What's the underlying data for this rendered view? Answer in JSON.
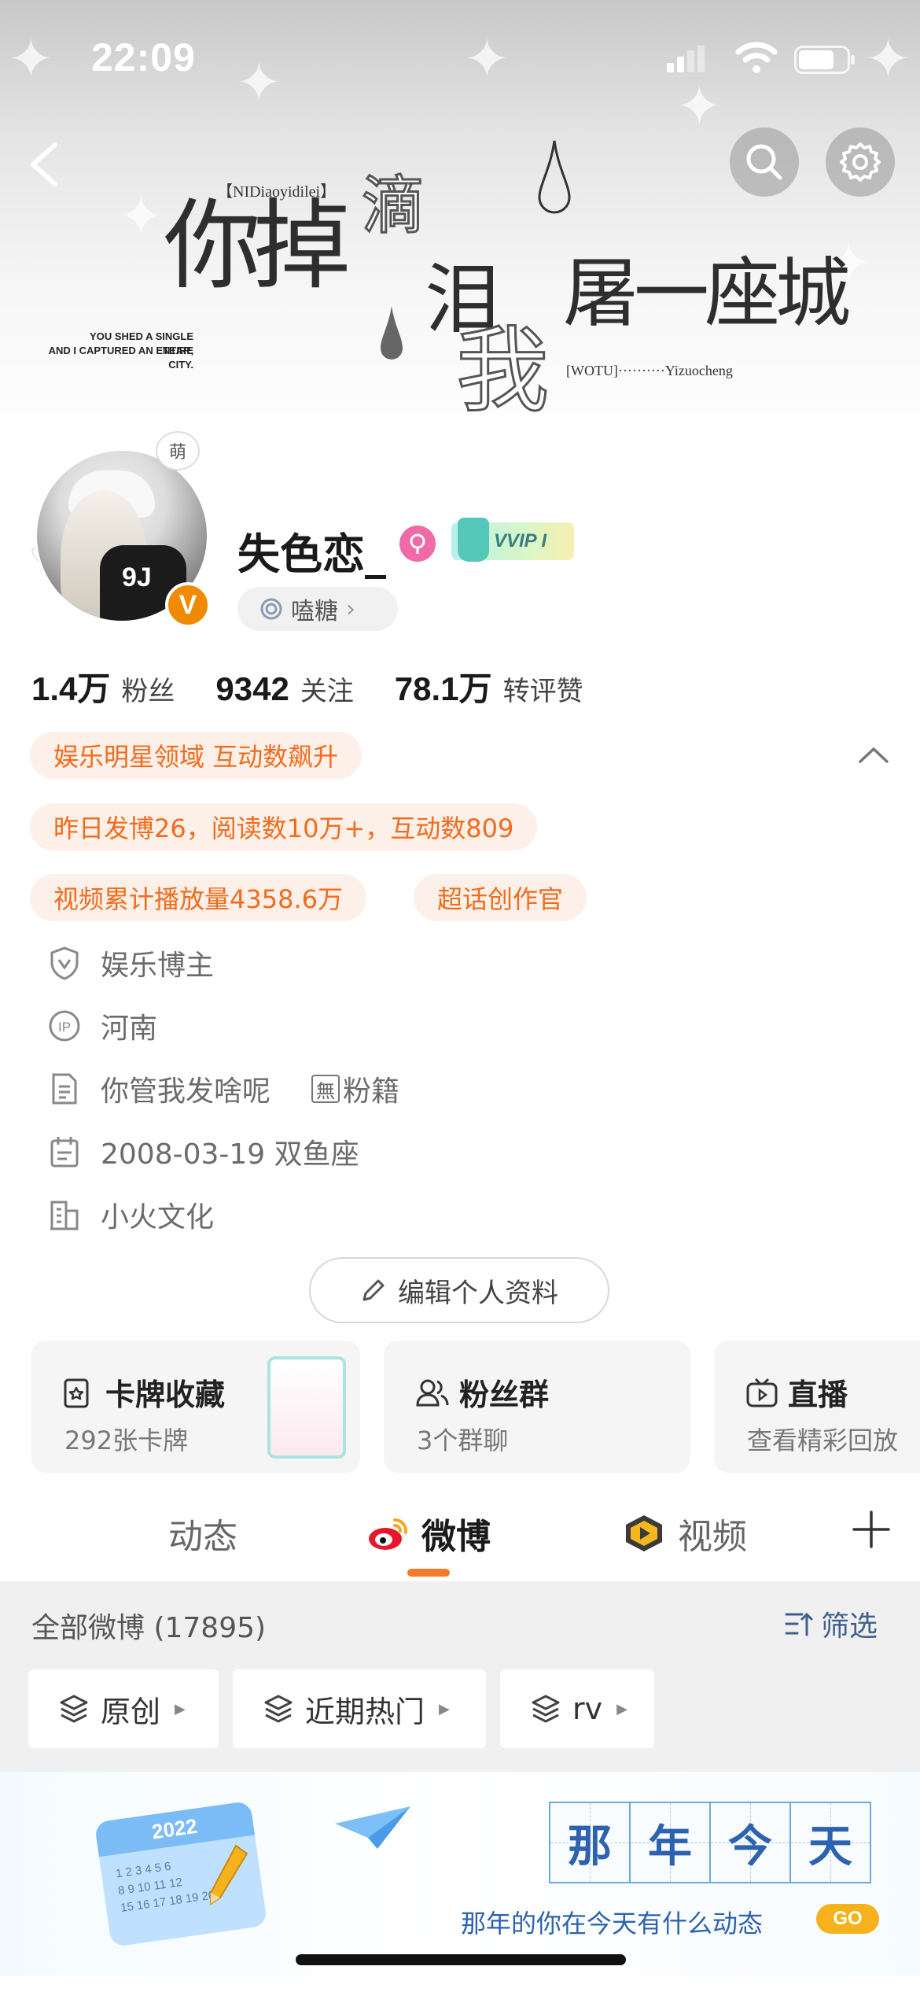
{
  "status": {
    "time": "22:09"
  },
  "cover": {
    "art_tag": "【NIDiaoyidilei】",
    "art_line1": "你掉",
    "art_line1_outline": "滴",
    "art_line2": "泪",
    "art_line2_outline": "我",
    "art_line3": "屠一座城",
    "art_caption_line1": "YOU SHED A SINGLE TEAR,",
    "art_caption_line2": "AND I CAPTURED AN ENTIRE CITY.",
    "art_tag2": "[WOTU]··········Yizuocheng"
  },
  "profile": {
    "name": "失色恋_",
    "vip_label": "VVIP I",
    "avatar_badge": "萌",
    "verified_mark": "V",
    "avatar_shirt_text": "9J",
    "tag_label": "嗑糖",
    "tag_chevron": "›"
  },
  "stats": [
    {
      "num": "1.4万",
      "label": "粉丝"
    },
    {
      "num": "9342",
      "label": "关注"
    },
    {
      "num": "78.1万",
      "label": "转评赞"
    }
  ],
  "honors": [
    "娱乐明星领域 互动数飙升",
    "昨日发博26，阅读数10万+，互动数809",
    "视频累计播放量4358.6万",
    "超话创作官"
  ],
  "info": {
    "role": "娱乐博主",
    "ip": "河南",
    "bio": "你管我发啥呢",
    "fan_box": "無",
    "fan_label": "粉籍",
    "birthday": "2008-03-19 双鱼座",
    "company": "小火文化"
  },
  "edit_label": "编辑个人资料",
  "cards": [
    {
      "title": "卡牌收藏",
      "sub": "292张卡牌"
    },
    {
      "title": "粉丝群",
      "sub": "3个群聊"
    },
    {
      "title": "直播",
      "sub": "查看精彩回放"
    }
  ],
  "tabs": [
    {
      "label": "动态"
    },
    {
      "label": "微博"
    },
    {
      "label": "视频"
    }
  ],
  "feed": {
    "count": "全部微博 (17895)",
    "filter": "筛选",
    "chips": [
      "原创",
      "近期热门",
      "rv"
    ]
  },
  "banner": {
    "title_chars": [
      "那",
      "年",
      "今",
      "天"
    ],
    "calendar_year": "2022",
    "calendar_nums": "1 2 3 4 5 6\n8 9 10 11 12\n15 16 17 18 19 20",
    "subtitle": "那年的你在今天有什么动态",
    "go": "GO"
  },
  "colors": {
    "accent_orange": "#f26b1d",
    "honor_bg": "#fdf0e8",
    "link_blue": "#3f5f8f"
  }
}
